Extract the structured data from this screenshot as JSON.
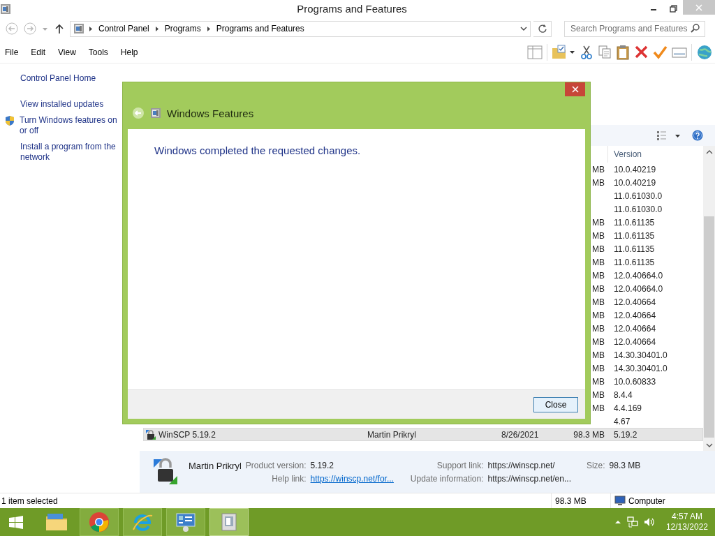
{
  "window": {
    "title": "Programs and Features"
  },
  "address_bar": {
    "breadcrumbs": [
      "Control Panel",
      "Programs",
      "Programs and Features"
    ]
  },
  "search": {
    "placeholder": "Search Programs and Features"
  },
  "menu": [
    "File",
    "Edit",
    "View",
    "Tools",
    "Help"
  ],
  "sidebar": {
    "items": [
      {
        "label": "Control Panel Home",
        "kind": "link"
      },
      {
        "label": "View installed updates",
        "kind": "link"
      },
      {
        "label": "Turn Windows features on or off",
        "kind": "shield"
      },
      {
        "label": "Install a program from the network",
        "kind": "link"
      }
    ]
  },
  "table": {
    "columns": [
      "Version"
    ],
    "rows": [
      {
        "size": "MB",
        "version": "10.0.40219",
        "selected": false
      },
      {
        "size": "MB",
        "version": "10.0.40219",
        "selected": false
      },
      {
        "version": "11.0.61030.0",
        "selected": false
      },
      {
        "version": "11.0.61030.0",
        "selected": false
      },
      {
        "size": "MB",
        "version": "11.0.61135",
        "selected": false
      },
      {
        "size": "MB",
        "version": "11.0.61135",
        "selected": false
      },
      {
        "size": "MB",
        "version": "11.0.61135",
        "selected": false
      },
      {
        "size": "MB",
        "version": "11.0.61135",
        "selected": false
      },
      {
        "size": "MB",
        "version": "12.0.40664.0",
        "selected": false
      },
      {
        "size": "MB",
        "version": "12.0.40664.0",
        "selected": false
      },
      {
        "size": "MB",
        "version": "12.0.40664",
        "selected": false
      },
      {
        "size": "MB",
        "version": "12.0.40664",
        "selected": false
      },
      {
        "size": "MB",
        "version": "12.0.40664",
        "selected": false
      },
      {
        "size": "MB",
        "version": "12.0.40664",
        "selected": false
      },
      {
        "size": "MB",
        "version": "14.30.30401.0",
        "selected": false
      },
      {
        "size": "MB",
        "version": "14.30.30401.0",
        "selected": false
      },
      {
        "size": "MB",
        "version": "10.0.60833",
        "selected": false
      },
      {
        "size": "MB",
        "version": "8.4.4",
        "selected": false
      },
      {
        "size": "MB",
        "version": "4.4.169",
        "selected": false
      },
      {
        "version": "4.67",
        "selected": false
      },
      {
        "name": "WinSCP 5.19.2",
        "publisher": "Martin Prikryl",
        "installed_on": "8/26/2021",
        "size": "98.3 MB",
        "version": "5.19.2",
        "selected": true
      }
    ]
  },
  "details": {
    "publisher": "Martin Prikryl",
    "rows": [
      [
        {
          "label": "Product version:",
          "value": "5.19.2"
        },
        {
          "label": "Support link:",
          "value": "https://winscp.net/"
        },
        {
          "label": "Size:",
          "value": "98.3 MB"
        }
      ],
      [
        {
          "label": "Help link:",
          "value": "https://winscp.net/for...",
          "kind": "link"
        },
        {
          "label": "Update information:",
          "value": "https://winscp.net/en..."
        }
      ]
    ]
  },
  "status_bar": {
    "selection": "1 item selected",
    "size": "98.3 MB",
    "location": "Computer"
  },
  "dialog": {
    "title": "Windows Features",
    "message": "Windows completed the requested changes.",
    "buttons": [
      "Close"
    ]
  },
  "taskbar": {
    "apps": [
      {
        "kind": "explorer",
        "running": false,
        "selected": false
      },
      {
        "kind": "chrome",
        "running": true,
        "selected": false
      },
      {
        "kind": "ie",
        "running": true,
        "selected": false
      },
      {
        "kind": "control",
        "running": true,
        "selected": false
      },
      {
        "kind": "programs",
        "running": true,
        "selected": true
      }
    ],
    "clock": {
      "time": "4:57 AM",
      "date": "12/13/2022"
    }
  }
}
